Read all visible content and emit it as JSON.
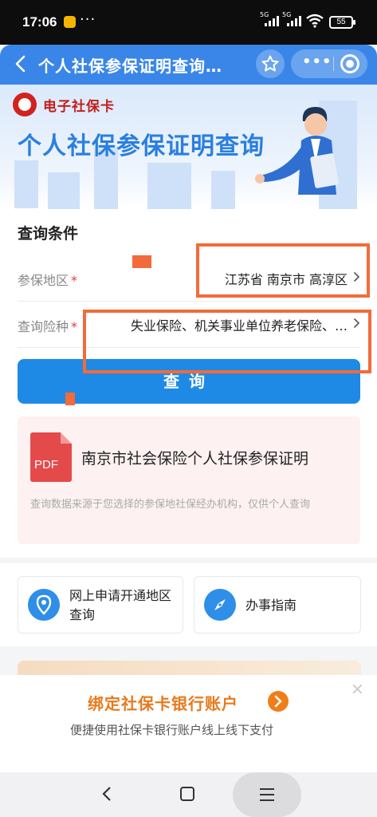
{
  "status_bar": {
    "time": "17:06",
    "more": "···",
    "signal1": "5G",
    "signal2": "5G",
    "battery": "55"
  },
  "header": {
    "title": "个人社保参保证明查询…",
    "more": "•••"
  },
  "banner": {
    "brand": "电子社保卡",
    "title": "个人社保参保证明查询"
  },
  "form": {
    "section_title": "查询条件",
    "region_label": "参保地区",
    "required_mark": "*",
    "region_value": "江苏省 南京市 高淳区",
    "type_label": "查询险种",
    "type_value": "失业保险、机关事业单位养老保险、…",
    "query_button": "查询"
  },
  "pdf_card": {
    "icon_text": "PDF",
    "title": "南京市社会保险个人社保参保证明",
    "note": "查询数据来源于您选择的参保地社保经办机构，仅供个人查询"
  },
  "shortcuts": {
    "apply_label": "网上申请开通地区查询",
    "guide_label": "办事指南"
  },
  "bind_banner": {
    "title": "绑定社保卡银行账户",
    "subtitle": "便捷使用社保卡银行账户线上线下支付",
    "close": "✕"
  },
  "colors": {
    "primary": "#1f8ae6",
    "header": "#3a86e8",
    "highlight": "#f26b3a",
    "accent_orange": "#e87a1c",
    "pdf_red": "#e44a4a"
  }
}
